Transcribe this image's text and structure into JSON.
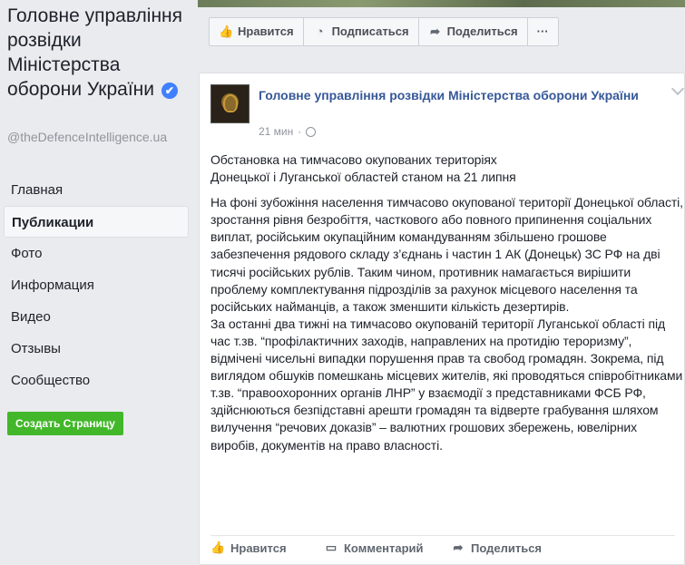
{
  "page": {
    "name": "Головне управління розвідки Міністерства оборони України",
    "verified_mark": "✔",
    "handle": "@theDefenceIntelligence.ua"
  },
  "nav": {
    "items": [
      {
        "label": "Главная",
        "active": false
      },
      {
        "label": "Публикации",
        "active": true
      },
      {
        "label": "Фото",
        "active": false
      },
      {
        "label": "Информация",
        "active": false
      },
      {
        "label": "Видео",
        "active": false
      },
      {
        "label": "Отзывы",
        "active": false
      },
      {
        "label": "Сообщество",
        "active": false
      }
    ],
    "create_page_label": "Создать Страницу"
  },
  "action_bar": {
    "like_label": "Нравится",
    "subscribe_label": "Подписаться",
    "share_label": "Поделиться",
    "more_label": "···"
  },
  "post": {
    "author": "Головне управління розвідки Міністерства оборони України",
    "time": "21 мин",
    "title_line1": "Обстановка на тимчасово окупованих територіях",
    "title_line2": "Донецької і Луганської областей станом на 21 липня",
    "paragraph1": "На фоні зубожіння населення тимчасово окупованої території Донецької області, зростання рівня безробіття, часткового або повного припинення соціальних виплат, російським окупаційним командуванням збільшено грошове забезпечення рядового складу з’єднань і частин 1 АК (Донецьк) ЗС РФ на дві тисячі російських рублів. Таким чином, противник намагається вирішити проблему комплектування підрозділів за рахунок місцевого населення та російських найманців, а також зменшити кількість дезертирів.",
    "paragraph2": "За останні два тижні на тимчасово окупованій території Луганської області під час т.зв. “профілактичних заходів, направлених на протидію тероризму”, відмічені чисельні випадки порушення прав та свобод громадян. Зокрема, під виглядом обшуків помешкань місцевих жителів, які проводяться співробітниками т.зв. “правоохоронних органів ЛНР” у взаємодії з представниками ФСБ РФ, здійснюються безпідставні арешти громадян та відверте грабування шляхом вилучення “речових доказів” – валютних грошових збережень, ювелірних виробів, документів на право власності."
  },
  "post_footer": {
    "like_label": "Нравится",
    "comment_label": "Комментарий",
    "share_label": "Поделиться"
  },
  "colors": {
    "link": "#365899",
    "create_button": "#42b72a",
    "background": "#e9ebee",
    "verified": "#4080ff"
  },
  "icons": [
    "thumbs-up-icon",
    "rss-icon",
    "share-arrow-icon",
    "more-icon",
    "globe-icon",
    "comment-icon",
    "chevron-down-icon",
    "verified-badge-icon"
  ]
}
